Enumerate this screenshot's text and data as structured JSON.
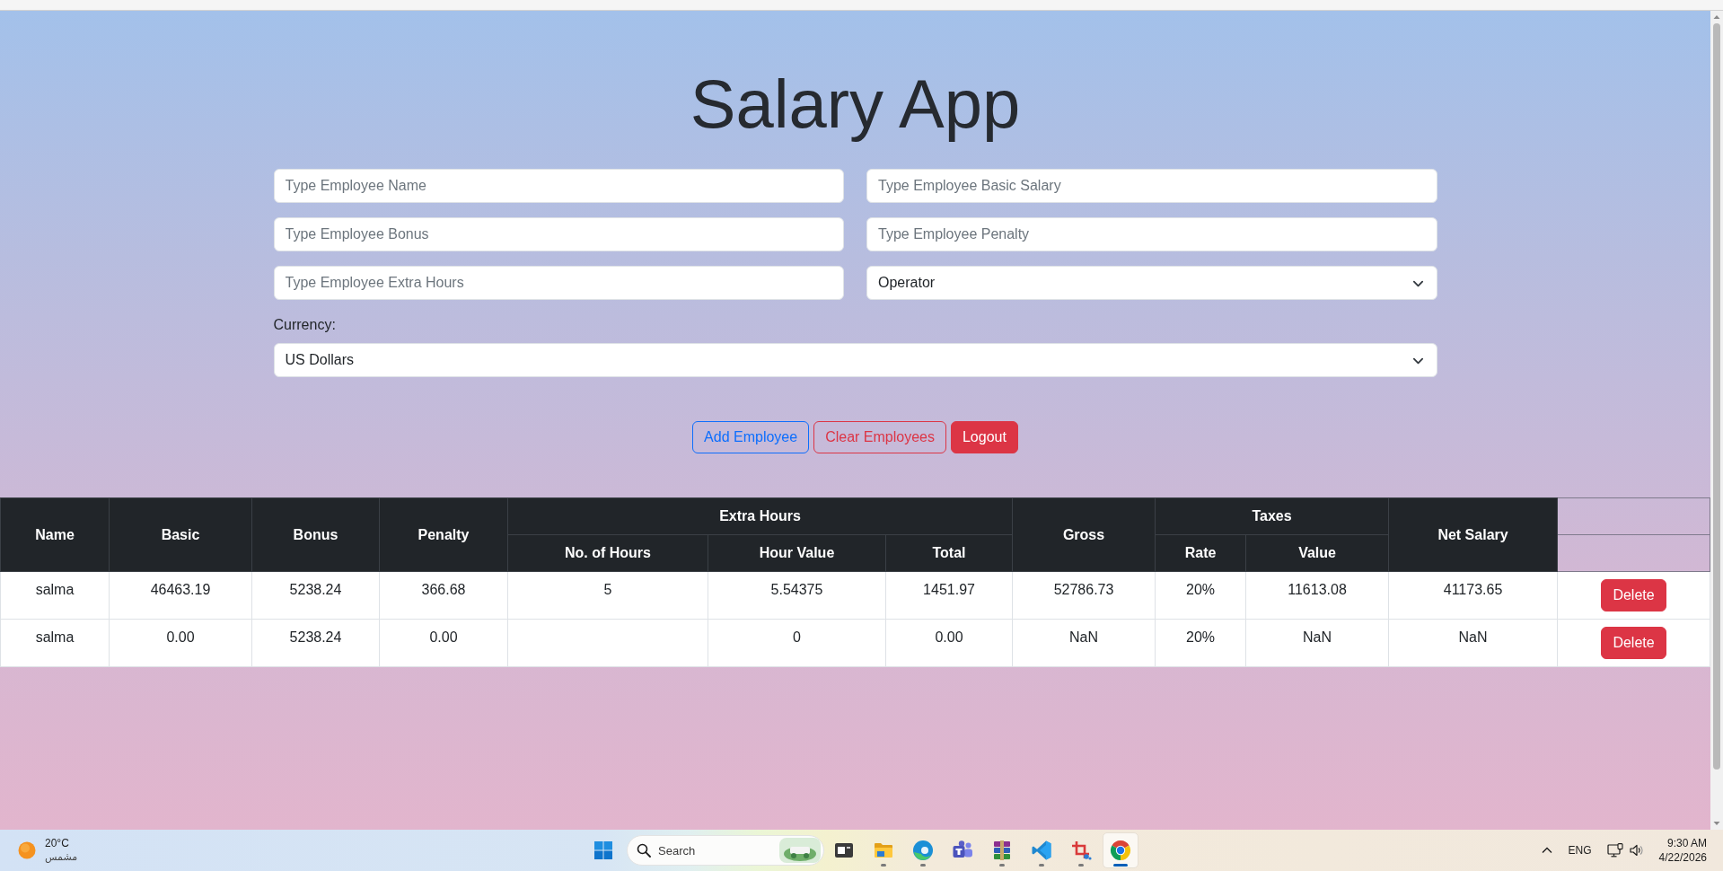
{
  "title": "Salary App",
  "form": {
    "fields": [
      {
        "kind": "input",
        "placeholder": "Type Employee Name"
      },
      {
        "kind": "input",
        "placeholder": "Type Employee Basic Salary"
      },
      {
        "kind": "input",
        "placeholder": "Type Employee Bonus"
      },
      {
        "kind": "input",
        "placeholder": "Type Employee Penalty"
      },
      {
        "kind": "input",
        "placeholder": "Type Employee Extra Hours"
      },
      {
        "kind": "select",
        "value": "Operator"
      }
    ],
    "currency": {
      "label": "Currency:",
      "value": "US Dollars"
    }
  },
  "buttons": [
    {
      "label": "Add Employee",
      "kind": "outline-primary"
    },
    {
      "label": "Clear Employees",
      "kind": "outline-danger"
    },
    {
      "label": "Logout",
      "kind": "danger"
    }
  ],
  "table": {
    "header_rows": [
      [
        {
          "label": "Name",
          "rowspan": 2
        },
        {
          "label": "Basic",
          "rowspan": 2
        },
        {
          "label": "Bonus",
          "rowspan": 2
        },
        {
          "label": "Penalty",
          "rowspan": 2
        },
        {
          "label": "Extra Hours",
          "colspan": 3
        },
        {
          "label": "Gross",
          "rowspan": 2
        },
        {
          "label": "Taxes",
          "colspan": 2
        },
        {
          "label": "Net Salary",
          "rowspan": 2
        }
      ],
      [
        {
          "label": "No. of Hours"
        },
        {
          "label": "Hour Value"
        },
        {
          "label": "Total"
        },
        {
          "label": "Rate"
        },
        {
          "label": "Value"
        }
      ]
    ],
    "rows": [
      {
        "cells": [
          "salma",
          "46463.19",
          "5238.24",
          "366.68",
          "5",
          "5.54375",
          "1451.97",
          "52786.73",
          "20%",
          "11613.08",
          "41173.65"
        ],
        "action": "Delete"
      },
      {
        "cells": [
          "salma",
          "0.00",
          "5238.24",
          "0.00",
          null,
          "0",
          "0.00",
          "NaN",
          "20%",
          "NaN",
          "NaN"
        ],
        "action": "Delete"
      }
    ]
  },
  "taskbar": {
    "weather": {
      "temperature": "20°C",
      "condition": "مشمس"
    },
    "search": {
      "placeholder": "Search"
    },
    "apps": [
      {
        "kind": "window",
        "running": false,
        "selected": false
      },
      {
        "kind": "folder",
        "running": true,
        "selected": false
      },
      {
        "kind": "swirl",
        "running": true,
        "selected": false
      },
      {
        "kind": "people",
        "running": false,
        "selected": false
      },
      {
        "kind": "books",
        "running": true,
        "selected": false
      },
      {
        "kind": "ribbon",
        "running": true,
        "selected": false
      },
      {
        "kind": "crop",
        "running": true,
        "selected": false
      },
      {
        "kind": "wheel",
        "running": true,
        "selected": true
      }
    ],
    "tray": {
      "language": "ENG",
      "time": "9:30 AM",
      "date": "4/22/2026"
    }
  }
}
